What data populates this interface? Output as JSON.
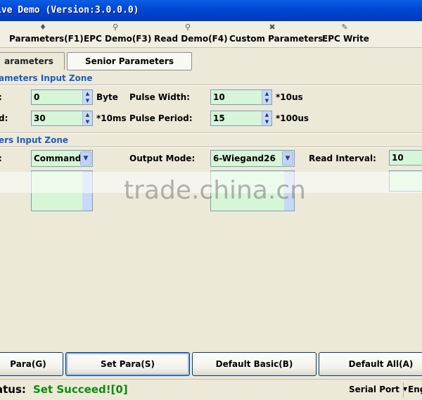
{
  "window": {
    "title": "ive Demo (Version:3.0.0.0)"
  },
  "toolbar": {
    "items": [
      {
        "label": "Parameters(F1)",
        "icon": "chip-icon"
      },
      {
        "label": "EPC Demo(F3)",
        "icon": "magnifier-icon"
      },
      {
        "label": "Read Demo(F4)",
        "icon": "magnifier-icon"
      },
      {
        "label": "Custom Parameters",
        "icon": "tools-icon"
      },
      {
        "label": "EPC Write",
        "icon": "write-icon"
      }
    ]
  },
  "tabs": [
    {
      "label": "arameters",
      "active": true
    },
    {
      "label": "Senior Parameters",
      "active": false
    }
  ],
  "basic": {
    "heading": "ameters Input Zone",
    "row1": {
      "left_label": ":",
      "left_value": "0",
      "left_unit": "Byte",
      "right_label": "Pulse Width:",
      "right_value": "10",
      "right_unit": "*10us"
    },
    "row2": {
      "left_label": "d:",
      "left_value": "30",
      "left_unit": "*10ms",
      "right_label": "Pulse Period:",
      "right_value": "15",
      "right_unit": "*100us"
    }
  },
  "senior": {
    "heading": "ers Input Zone",
    "left_label": ":",
    "mode_value": "Command",
    "output_label": "Output Mode:",
    "output_value": "6-Wiegand26",
    "interval_label": "Read Interval:",
    "interval_value": "10"
  },
  "watermark": "trade.china.cn",
  "buttons": {
    "get_para": "Para(G)",
    "set_para": "Set Para(S)",
    "default_basic": "Default Basic(B)",
    "default_all": "Default All(A)"
  },
  "status": {
    "label": "atus:",
    "value": "Set Succeed![0]",
    "serial_port": "Serial Port",
    "language": "Eng"
  },
  "colors": {
    "accent_blue": "#1e5cc0",
    "field_green": "#d7f5d7",
    "status_green": "#0a8c0a",
    "title_blue": "#0046d5"
  }
}
